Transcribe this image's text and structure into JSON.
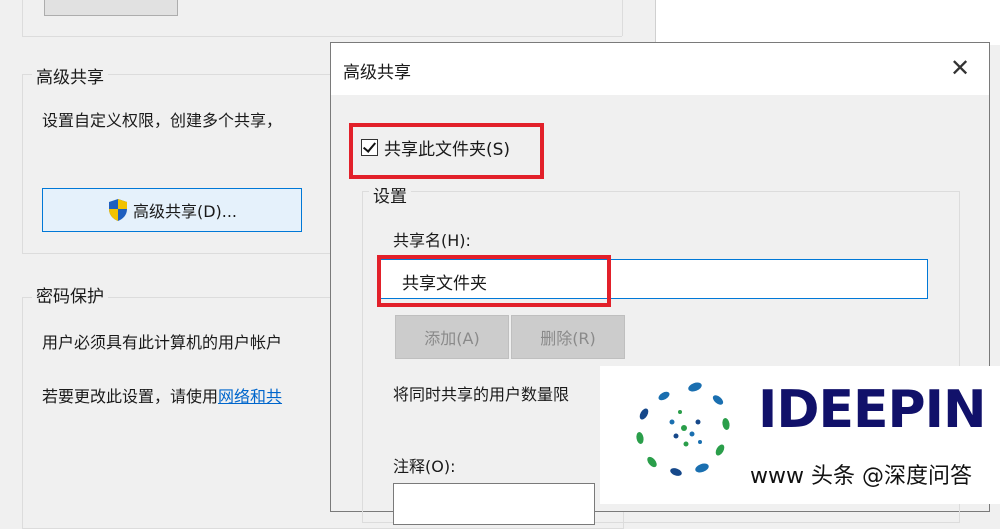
{
  "background_window": {
    "advanced_sharing_group_title": "高级共享",
    "advanced_sharing_desc": "设置自定义权限，创建多个共享，",
    "advanced_sharing_button": "高级共享(D)...",
    "password_group_title": "密码保护",
    "password_desc": "用户必须具有此计算机的用户帐户",
    "change_setting_prefix": "若要更改此设置，请使用",
    "change_setting_link": "网络和共"
  },
  "dialog": {
    "title": "高级共享",
    "close_glyph": "✕",
    "share_checkbox_label": "共享此文件夹(S)",
    "share_checkbox_checked": true,
    "settings_group_title": "设置",
    "share_name_label": "共享名(H):",
    "share_name_value": "共享文件夹",
    "add_button": "添加(A)",
    "remove_button": "删除(R)",
    "limit_users_text": "将同时共享的用户数量限",
    "notes_label": "注释(O):"
  },
  "watermark": {
    "brand": "IDEEPIN",
    "domain_tag": "www",
    "toutiao_text": "头条 @深度问答"
  },
  "colors": {
    "highlight_red": "#e2202a",
    "focus_blue": "#0078d7",
    "brand_navy": "#11116a"
  }
}
